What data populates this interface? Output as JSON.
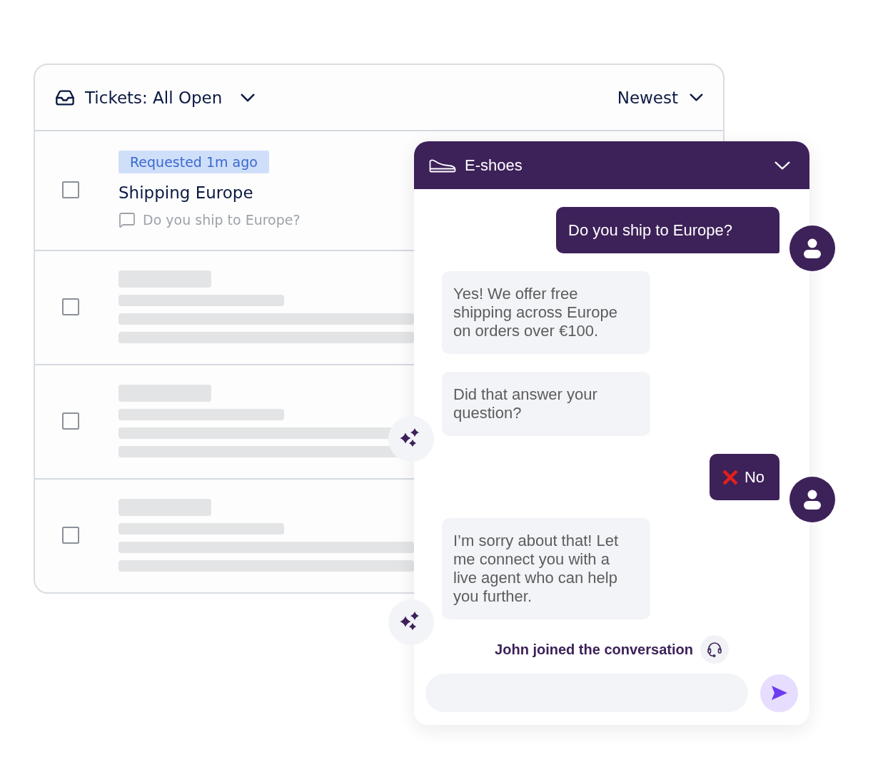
{
  "ticket_list": {
    "filter": {
      "label": "Tickets: All Open"
    },
    "sort": {
      "label": "Newest"
    },
    "rows": [
      {
        "kind": "ticket",
        "checked": false,
        "badge": "Requested 1m ago",
        "title": "Shipping Europe",
        "preview": "Do you ship to Europe?"
      },
      {
        "kind": "placeholder",
        "checked": false
      },
      {
        "kind": "placeholder",
        "checked": false
      },
      {
        "kind": "placeholder",
        "checked": false
      }
    ]
  },
  "chat": {
    "title": "E-shoes",
    "messages": [
      {
        "kind": "user",
        "text": "Do you ship to Europe?"
      },
      {
        "kind": "bot",
        "text": "Yes! We offer free shipping across Europe on orders over €100."
      },
      {
        "kind": "bot",
        "text": "Did that answer your question?"
      },
      {
        "kind": "feedback",
        "text": "No"
      },
      {
        "kind": "bot",
        "text": "I’m sorry about that! Let me connect you with a live agent who can help you further."
      },
      {
        "kind": "event",
        "text": "John joined the conversation"
      }
    ]
  }
}
